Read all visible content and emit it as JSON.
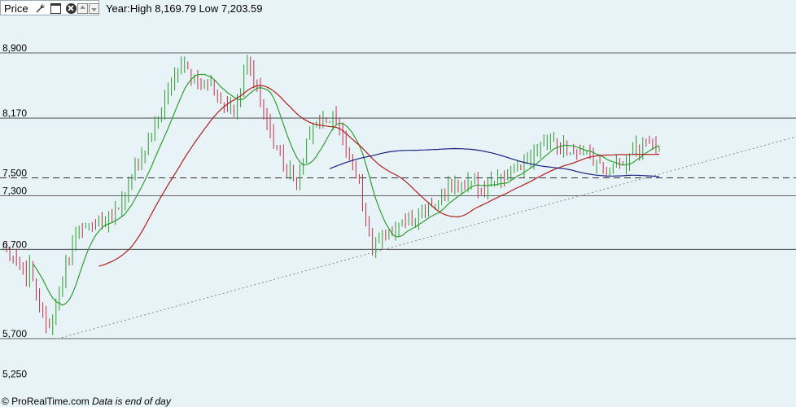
{
  "toolbar": {
    "title": "Price",
    "icons": [
      "wrench-icon",
      "window-icon",
      "close-icon",
      "move-up-icon",
      "move-down-icon"
    ],
    "year_info": "Year:High 8,169.79 Low 7,203.59"
  },
  "footer": {
    "brand": "© ProRealTime.com",
    "note": "Data is end of day"
  },
  "colors": {
    "background": "#e8f3f8",
    "up_candle": "#2e9a2e",
    "down_candle": "#c0304a",
    "ma_short": "#2ea02e",
    "ma_medium": "#b01e1e",
    "ma_long": "#1a237e",
    "trendline": "#888888",
    "level_line": "#333333"
  },
  "chart_data": {
    "type": "line",
    "y_axis": {
      "ticks": [
        8900,
        8170,
        7500,
        7300,
        6700,
        5700,
        5250
      ],
      "tick_labels": [
        "8,900",
        "8,170",
        "7,500",
        "7,300",
        "6,700",
        "5,700",
        "5,250"
      ],
      "range": [
        5080,
        9310
      ],
      "scale": "linear",
      "position": "left"
    },
    "horizontal_levels": [
      {
        "value": 8900,
        "style": "solid"
      },
      {
        "value": 8170,
        "style": "solid"
      },
      {
        "value": 7500,
        "style": "dashed"
      },
      {
        "value": 7300,
        "style": "solid"
      },
      {
        "value": 6700,
        "style": "solid"
      },
      {
        "value": 5700,
        "style": "solid"
      }
    ],
    "bar_count": 200,
    "price_path_anchors": [
      [
        0,
        6740
      ],
      [
        15,
        6420
      ],
      [
        17,
        6540
      ],
      [
        20,
        6270
      ],
      [
        28,
        5830
      ],
      [
        34,
        6020
      ],
      [
        40,
        6500
      ],
      [
        48,
        6950
      ],
      [
        56,
        6960
      ],
      [
        66,
        7060
      ],
      [
        75,
        7180
      ],
      [
        84,
        7600
      ],
      [
        95,
        7960
      ],
      [
        107,
        8530
      ],
      [
        117,
        8840
      ],
      [
        125,
        8510
      ],
      [
        133,
        8560
      ],
      [
        141,
        8310
      ],
      [
        149,
        8230
      ],
      [
        157,
        8850
      ],
      [
        165,
        8400
      ],
      [
        173,
        7900
      ],
      [
        181,
        7600
      ],
      [
        189,
        7470
      ],
      [
        197,
        8050
      ],
      [
        205,
        8130
      ],
      [
        213,
        8140
      ],
      [
        221,
        7790
      ],
      [
        229,
        7400
      ],
      [
        233,
        6970
      ],
      [
        237,
        6750
      ],
      [
        245,
        6850
      ],
      [
        253,
        6920
      ],
      [
        261,
        6980
      ],
      [
        269,
        7100
      ],
      [
        277,
        7200
      ],
      [
        285,
        7350
      ],
      [
        293,
        7420
      ],
      [
        301,
        7420
      ],
      [
        309,
        7390
      ],
      [
        317,
        7510
      ],
      [
        325,
        7520
      ],
      [
        333,
        7650
      ],
      [
        341,
        7820
      ],
      [
        349,
        7960
      ],
      [
        357,
        7850
      ],
      [
        365,
        7800
      ],
      [
        373,
        7800
      ],
      [
        381,
        7640
      ],
      [
        389,
        7560
      ],
      [
        397,
        7700
      ],
      [
        405,
        7800
      ],
      [
        413,
        7900
      ],
      [
        421,
        7880
      ]
    ],
    "trendline": {
      "from": [
        35,
        5700
      ],
      "to": [
        496,
        7900
      ],
      "style": "dotted"
    },
    "series": [
      {
        "type": "candlestick"
      },
      {
        "type": "moving_average",
        "color": "#2ea02e",
        "period": 10
      },
      {
        "type": "moving_average",
        "color": "#b01e1e",
        "period": 30
      },
      {
        "type": "moving_average",
        "color": "#1a237e",
        "period": 100
      }
    ],
    "title": "",
    "xlabel": "",
    "ylabel": ""
  }
}
